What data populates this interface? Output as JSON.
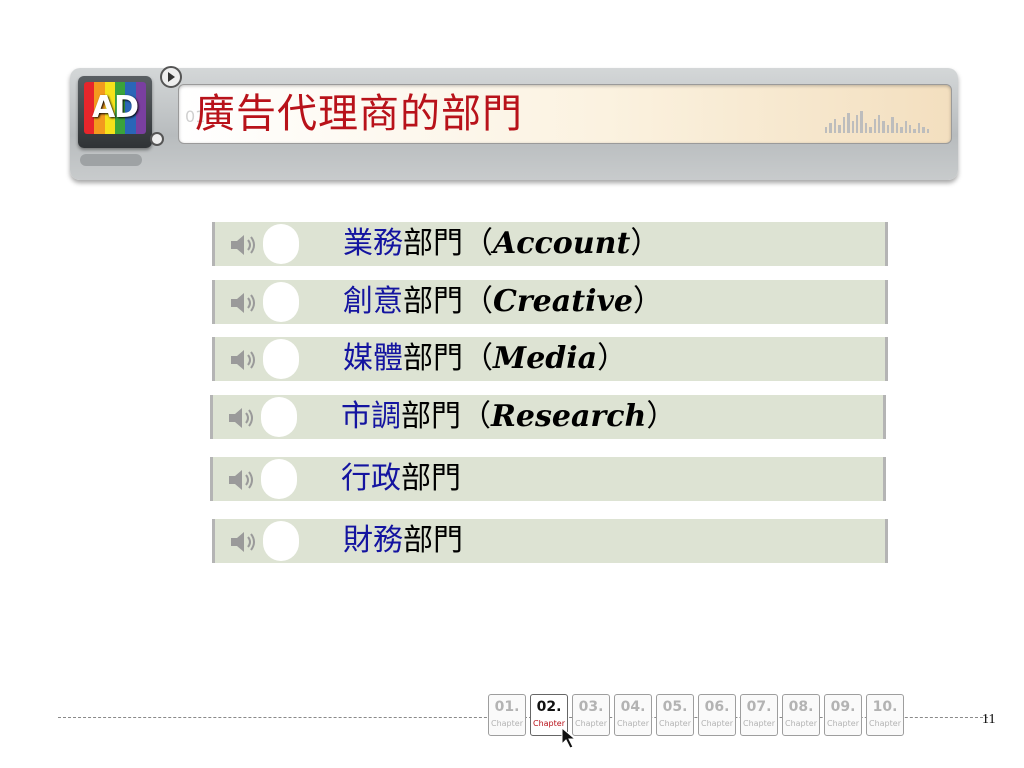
{
  "header": {
    "title": "廣告代理商的部門",
    "logo_text": "AD",
    "ghost_text": "01",
    "logo_colors": [
      "#e8262b",
      "#f39a1e",
      "#f6e21a",
      "#3aa33b",
      "#2a66b8",
      "#7a3fa0"
    ]
  },
  "departments": [
    {
      "highlight": "業務",
      "suffix": "部門",
      "open": "（",
      "english": "Account",
      "close": "）"
    },
    {
      "highlight": "創意",
      "suffix": "部門",
      "open": "（",
      "english": "Creative",
      "close": "）"
    },
    {
      "highlight": "媒體",
      "suffix": "部門",
      "open": "（",
      "english": "Media",
      "close": "）"
    },
    {
      "highlight": "市調",
      "suffix": "部門",
      "open": "（",
      "english": "Research",
      "close": "）"
    },
    {
      "highlight": "行政",
      "suffix": "部門",
      "open": "",
      "english": "",
      "close": ""
    },
    {
      "highlight": "財務",
      "suffix": "部門",
      "open": "",
      "english": "",
      "close": ""
    }
  ],
  "chapters": [
    {
      "num": "01.",
      "label": "Chapter"
    },
    {
      "num": "02.",
      "label": "Chapter",
      "active": true
    },
    {
      "num": "03.",
      "label": "Chapter"
    },
    {
      "num": "04.",
      "label": "Chapter"
    },
    {
      "num": "05.",
      "label": "Chapter"
    },
    {
      "num": "06.",
      "label": "Chapter"
    },
    {
      "num": "07.",
      "label": "Chapter"
    },
    {
      "num": "08.",
      "label": "Chapter"
    },
    {
      "num": "09.",
      "label": "Chapter"
    },
    {
      "num": "10.",
      "label": "Chapter"
    }
  ],
  "footer": {
    "page_number": "11"
  },
  "colors": {
    "title_red": "#b8121a",
    "highlight_blue": "#1414a0",
    "row_bg": "#dde3d3"
  }
}
